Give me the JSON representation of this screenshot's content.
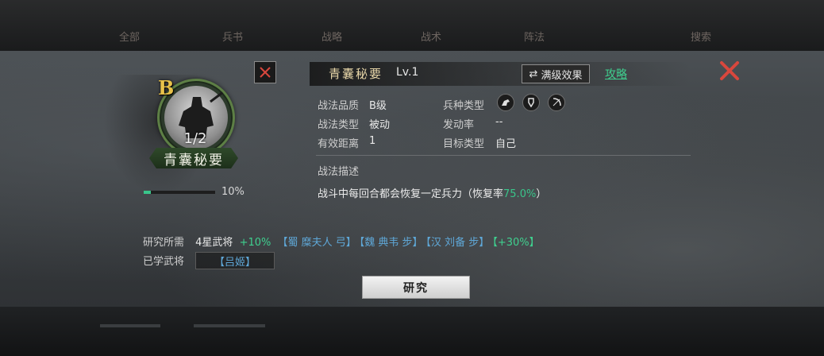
{
  "background": {
    "tabs": [
      "全部",
      "兵书",
      "战略",
      "战术",
      "阵法",
      "搜索"
    ]
  },
  "tactic": {
    "grade": "B",
    "count": "1/2",
    "name": "青囊秘要",
    "level": "Lv.1",
    "progress_percent": 10,
    "progress_text": "10%"
  },
  "header": {
    "max_effect_label": "满级效果",
    "guide_label": "攻略"
  },
  "attributes": {
    "quality_label": "战法品质",
    "quality_value": "B级",
    "type_label": "战法类型",
    "type_value": "被动",
    "range_label": "有效距离",
    "range_value": "1",
    "unit_label": "兵种类型",
    "unit_icons": [
      "cavalry-icon",
      "shield-icon",
      "bow-icon"
    ],
    "trigger_label": "发动率",
    "trigger_value": "--",
    "target_label": "目标类型",
    "target_value": "自己"
  },
  "description": {
    "title": "战法描述",
    "text_before": "战斗中每回合都会恢复一定兵力（恢复率",
    "rate": "75.0%",
    "text_after": "）"
  },
  "research": {
    "label": "研究所需",
    "requirement": "4星武将",
    "bonus1": "+10%",
    "generals": [
      "【蜀 糜夫人 弓】",
      "【魏 典韦 步】",
      "【汉 刘备 步】"
    ],
    "bonus2": "【+30%】",
    "learned_label": "已学武将",
    "learned_value": "【吕姬】",
    "button_label": "研究"
  },
  "colors": {
    "accent_green": "#39c58a",
    "close_red": "#d8473d",
    "grade_gold": "#e8c24a",
    "general_blue": "#5fa8d8"
  }
}
